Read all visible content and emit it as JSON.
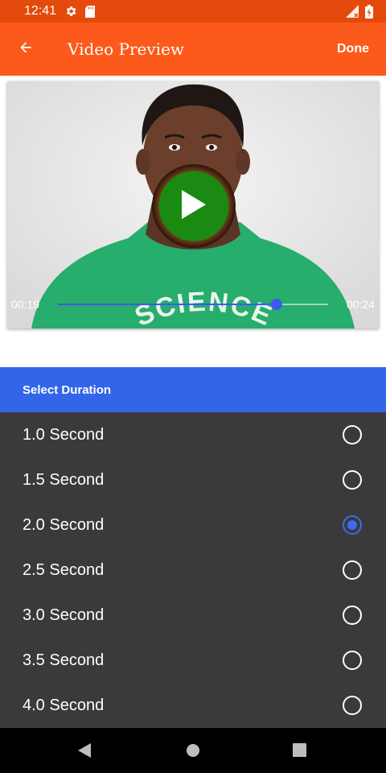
{
  "status_bar": {
    "time": "12:41"
  },
  "app_bar": {
    "title": "Video Preview",
    "done_label": "Done"
  },
  "video": {
    "current_time": "00:19",
    "total_time": "00:24",
    "shirt_text": "SCIENCE",
    "progress_fraction": 0.81
  },
  "duration": {
    "header": "Select Duration",
    "options": [
      {
        "label": "1.0 Second",
        "selected": false
      },
      {
        "label": "1.5 Second",
        "selected": false
      },
      {
        "label": "2.0 Second",
        "selected": true
      },
      {
        "label": "2.5 Second",
        "selected": false
      },
      {
        "label": "3.0 Second",
        "selected": false
      },
      {
        "label": "3.5 Second",
        "selected": false
      },
      {
        "label": "4.0 Second",
        "selected": false
      }
    ]
  },
  "colors": {
    "status_bar": "#e34a0c",
    "app_bar": "#fb5a1a",
    "accent_blue": "#3265e8",
    "list_bg": "#3a3a3a",
    "play_green": "#1a8a12"
  }
}
